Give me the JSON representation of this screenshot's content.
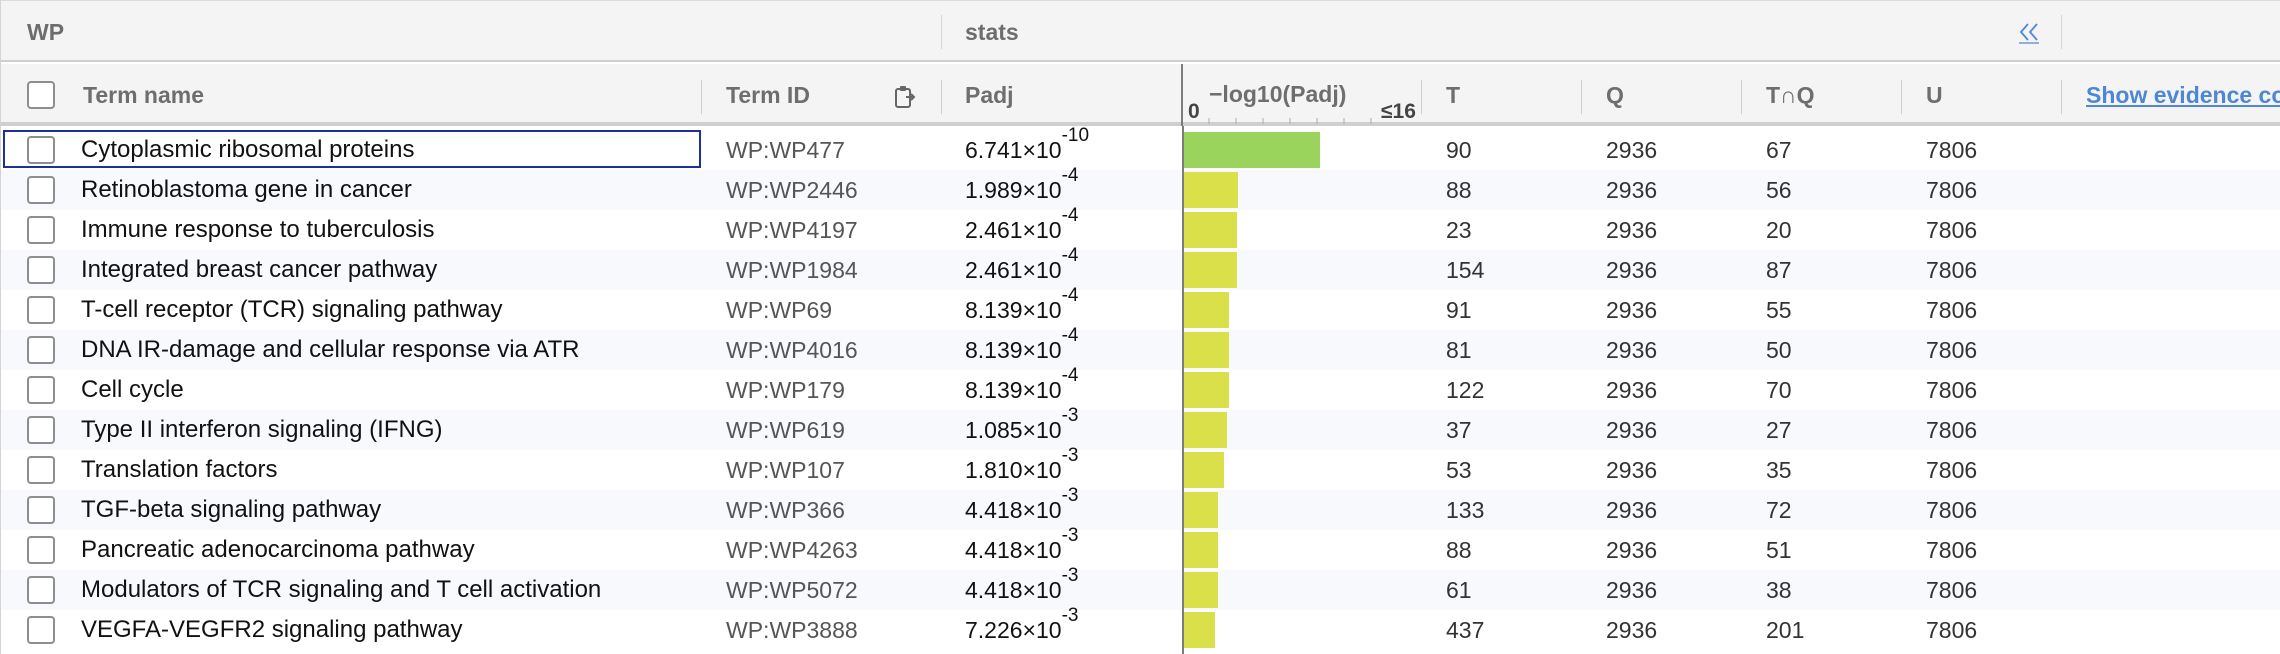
{
  "group_header": {
    "source": "WP",
    "stats": "stats",
    "collapse_icon": "double-chevron-left-icon"
  },
  "columns": {
    "term_name": "Term name",
    "term_id": "Term ID",
    "padj": "Padj",
    "neglog": "−log10(Padj)",
    "axis_min": "0",
    "axis_max": "≤16",
    "t": "T",
    "q": "Q",
    "tq": "T∩Q",
    "u": "U",
    "evidence": "Show evidence codes"
  },
  "colors": {
    "bar_top": "#9ad45c",
    "bar_other": "#d9e04a",
    "selection": "#1c2f9c",
    "link": "#4f86d6"
  },
  "rows": [
    {
      "name": "Cytoplasmic ribosomal proteins",
      "id": "WP:WP477",
      "padj_mant": "6.741×10",
      "padj_exp": "-10",
      "neglog": 9.17,
      "t": "90",
      "q": "2936",
      "tq": "67",
      "u": "7806"
    },
    {
      "name": "Retinoblastoma gene in cancer",
      "id": "WP:WP2446",
      "padj_mant": "1.989×10",
      "padj_exp": "-4",
      "neglog": 3.7,
      "t": "88",
      "q": "2936",
      "tq": "56",
      "u": "7806"
    },
    {
      "name": "Immune response to tuberculosis",
      "id": "WP:WP4197",
      "padj_mant": "2.461×10",
      "padj_exp": "-4",
      "neglog": 3.61,
      "t": "23",
      "q": "2936",
      "tq": "20",
      "u": "7806"
    },
    {
      "name": "Integrated breast cancer pathway",
      "id": "WP:WP1984",
      "padj_mant": "2.461×10",
      "padj_exp": "-4",
      "neglog": 3.61,
      "t": "154",
      "q": "2936",
      "tq": "87",
      "u": "7806"
    },
    {
      "name": "T-cell receptor (TCR) signaling pathway",
      "id": "WP:WP69",
      "padj_mant": "8.139×10",
      "padj_exp": "-4",
      "neglog": 3.09,
      "t": "91",
      "q": "2936",
      "tq": "55",
      "u": "7806"
    },
    {
      "name": "DNA IR-damage and cellular response via ATR",
      "id": "WP:WP4016",
      "padj_mant": "8.139×10",
      "padj_exp": "-4",
      "neglog": 3.09,
      "t": "81",
      "q": "2936",
      "tq": "50",
      "u": "7806"
    },
    {
      "name": "Cell cycle",
      "id": "WP:WP179",
      "padj_mant": "8.139×10",
      "padj_exp": "-4",
      "neglog": 3.09,
      "t": "122",
      "q": "2936",
      "tq": "70",
      "u": "7806"
    },
    {
      "name": "Type II interferon signaling (IFNG)",
      "id": "WP:WP619",
      "padj_mant": "1.085×10",
      "padj_exp": "-3",
      "neglog": 2.96,
      "t": "37",
      "q": "2936",
      "tq": "27",
      "u": "7806"
    },
    {
      "name": "Translation factors",
      "id": "WP:WP107",
      "padj_mant": "1.810×10",
      "padj_exp": "-3",
      "neglog": 2.74,
      "t": "53",
      "q": "2936",
      "tq": "35",
      "u": "7806"
    },
    {
      "name": "TGF-beta signaling pathway",
      "id": "WP:WP366",
      "padj_mant": "4.418×10",
      "padj_exp": "-3",
      "neglog": 2.35,
      "t": "133",
      "q": "2936",
      "tq": "72",
      "u": "7806"
    },
    {
      "name": "Pancreatic adenocarcinoma pathway",
      "id": "WP:WP4263",
      "padj_mant": "4.418×10",
      "padj_exp": "-3",
      "neglog": 2.35,
      "t": "88",
      "q": "2936",
      "tq": "51",
      "u": "7806"
    },
    {
      "name": "Modulators of TCR signaling and T cell activation",
      "id": "WP:WP5072",
      "padj_mant": "4.418×10",
      "padj_exp": "-3",
      "neglog": 2.35,
      "t": "61",
      "q": "2936",
      "tq": "38",
      "u": "7806"
    },
    {
      "name": "VEGFA-VEGFR2 signaling pathway",
      "id": "WP:WP3888",
      "padj_mant": "7.226×10",
      "padj_exp": "-3",
      "neglog": 2.14,
      "t": "437",
      "q": "2936",
      "tq": "201",
      "u": "7806"
    }
  ]
}
